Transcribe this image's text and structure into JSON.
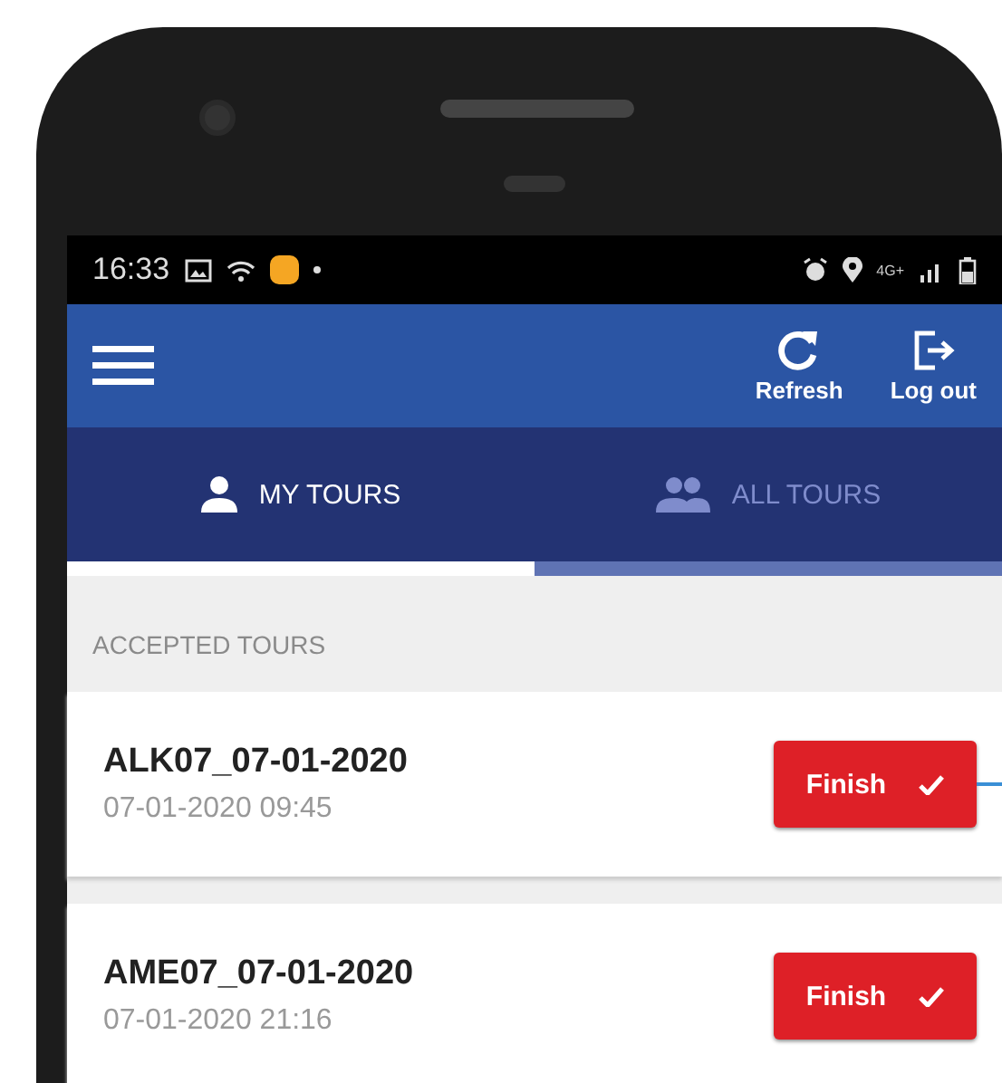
{
  "status_bar": {
    "time": "16:33",
    "network": "4G+"
  },
  "app_bar": {
    "actions": [
      {
        "label": "Refresh",
        "kind": "refresh"
      },
      {
        "label": "Log out",
        "kind": "logout"
      }
    ]
  },
  "tabs": [
    {
      "label": "MY TOURS",
      "selected": true,
      "kind": "person"
    },
    {
      "label": "ALL TOURS",
      "selected": false,
      "kind": "group"
    }
  ],
  "section_header": "ACCEPTED TOURS",
  "tours": [
    {
      "name": "ALK07_07-01-2020",
      "datetime": "07-01-2020 09:45",
      "button": "Finish"
    },
    {
      "name": "AME07_07-01-2020",
      "datetime": "07-01-2020 21:16",
      "button": "Finish"
    }
  ]
}
